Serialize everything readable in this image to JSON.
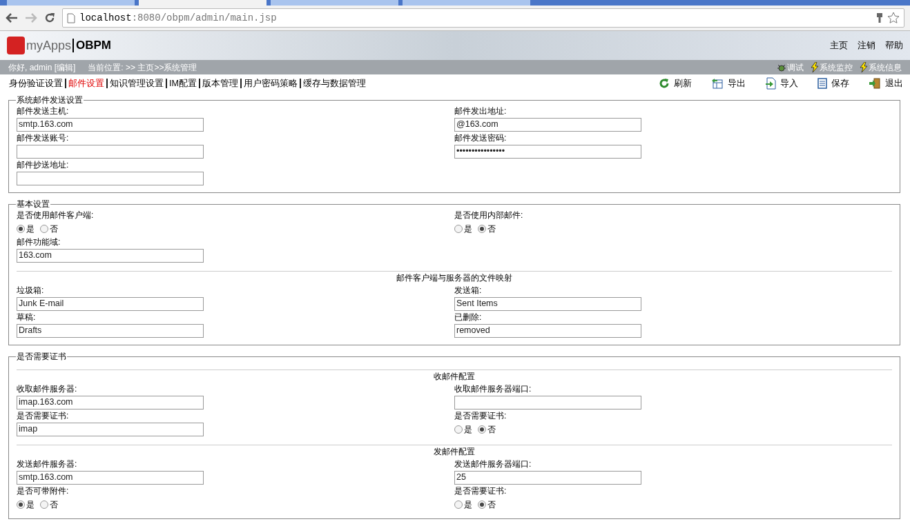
{
  "browser": {
    "tabs": [
      {
        "selected": false
      },
      {
        "selected": true
      },
      {
        "selected": false
      },
      {
        "selected": false
      }
    ],
    "url_host": "localhost",
    "url_path": ":8080/obpm/admin/main.jsp"
  },
  "header": {
    "brand": "myApps",
    "product": "OBPM",
    "links": [
      "主页",
      "注销",
      "帮助"
    ]
  },
  "info_bar": {
    "greeting": "你好, admin [编辑]",
    "location": "当前位置: >> 主页>>系统管理",
    "tools": [
      {
        "label": "调试",
        "kind": "bug"
      },
      {
        "label": "系统监控",
        "kind": "bolt"
      },
      {
        "label": "系统信息",
        "kind": "bolt"
      }
    ]
  },
  "tabs": [
    {
      "label": "身份验证设置",
      "selected": false
    },
    {
      "label": "邮件设置",
      "selected": true
    },
    {
      "label": "知识管理设置",
      "selected": false
    },
    {
      "label": "IM配置",
      "selected": false
    },
    {
      "label": "版本管理",
      "selected": false
    },
    {
      "label": "用户密码策略",
      "selected": false
    },
    {
      "label": "缓存与数据管理",
      "selected": false
    }
  ],
  "toolbar": [
    {
      "label": "刷新",
      "kind": "refresh"
    },
    {
      "label": "导出",
      "kind": "export"
    },
    {
      "label": "导入",
      "kind": "import"
    },
    {
      "label": "保存",
      "kind": "save"
    },
    {
      "label": "退出",
      "kind": "exit"
    }
  ],
  "sections": [
    {
      "legend": "系统邮件发送设置",
      "rows": [
        {
          "kind": "fields",
          "items": [
            {
              "label": "邮件发送主机:",
              "kind": "text",
              "value": "smtp.163.com"
            },
            {
              "label": "邮件发出地址:",
              "kind": "text",
              "value": "@163.com"
            }
          ]
        },
        {
          "kind": "fields",
          "items": [
            {
              "label": "邮件发送账号:",
              "kind": "text"
            },
            {
              "label": "邮件发送密码:",
              "kind": "text",
              "value": "••••••••••••••••"
            }
          ]
        },
        {
          "kind": "fields",
          "items": [
            {
              "label": "邮件抄送地址:",
              "kind": "text"
            }
          ]
        }
      ]
    },
    {
      "legend": "基本设置",
      "rows": [
        {
          "kind": "fields",
          "items": [
            {
              "label": "是否使用邮件客户端:",
              "kind": "radio",
              "options": [
                {
                  "label": "是",
                  "selected": true
                },
                {
                  "label": "否",
                  "selected": false
                }
              ]
            },
            {
              "label": "是否使用内部邮件:",
              "kind": "radio",
              "options": [
                {
                  "label": "是",
                  "selected": false
                },
                {
                  "label": "否",
                  "selected": true
                }
              ]
            }
          ]
        },
        {
          "kind": "fields",
          "items": [
            {
              "label": "邮件功能域:",
              "kind": "text",
              "value": "163.com"
            }
          ]
        },
        {
          "kind": "divider",
          "title": "邮件客户端与服务器的文件映射"
        },
        {
          "kind": "fields",
          "items": [
            {
              "label": "垃圾箱:",
              "kind": "text",
              "value": "Junk E-mail"
            },
            {
              "label": "发送箱:",
              "kind": "text",
              "value": "Sent Items"
            }
          ]
        },
        {
          "kind": "fields",
          "items": [
            {
              "label": "草稿:",
              "kind": "text",
              "value": "Drafts"
            },
            {
              "label": "已删除:",
              "kind": "text",
              "value": "removed"
            }
          ]
        }
      ]
    },
    {
      "legend": "是否需要证书",
      "rows": [
        {
          "kind": "divider",
          "title": "收邮件配置"
        },
        {
          "kind": "fields",
          "items": [
            {
              "label": "收取邮件服务器:",
              "kind": "text",
              "value": "imap.163.com"
            },
            {
              "label": "收取邮件服务器端口:",
              "kind": "text"
            }
          ]
        },
        {
          "kind": "fields",
          "items": [
            {
              "label": "是否需要证书:",
              "kind": "text",
              "value": "imap"
            },
            {
              "label": "是否需要证书:",
              "kind": "radio",
              "options": [
                {
                  "label": "是",
                  "selected": false
                },
                {
                  "label": "否",
                  "selected": true
                }
              ]
            }
          ]
        },
        {
          "kind": "divider",
          "title": "发邮件配置"
        },
        {
          "kind": "fields",
          "items": [
            {
              "label": "发送邮件服务器:",
              "kind": "text",
              "value": "smtp.163.com"
            },
            {
              "label": "发送邮件服务器端口:",
              "kind": "text",
              "value": "25"
            }
          ]
        },
        {
          "kind": "fields",
          "items": [
            {
              "label": "是否可带附件:",
              "kind": "radio",
              "options": [
                {
                  "label": "是",
                  "selected": true
                },
                {
                  "label": "否",
                  "selected": false
                }
              ]
            },
            {
              "label": "是否需要证书:",
              "kind": "radio",
              "options": [
                {
                  "label": "是",
                  "selected": false
                },
                {
                  "label": "否",
                  "selected": true
                }
              ]
            }
          ]
        }
      ]
    }
  ]
}
